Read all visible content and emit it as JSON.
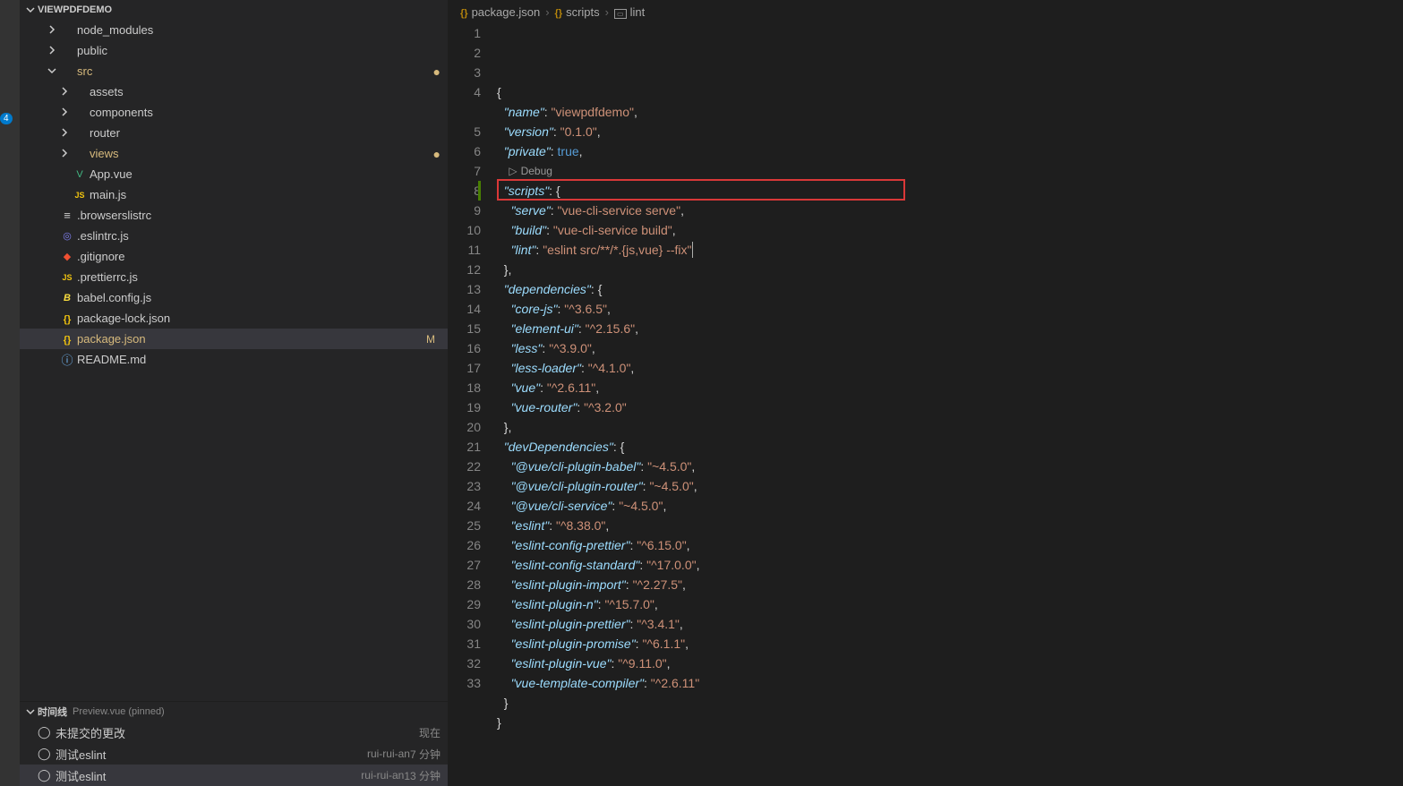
{
  "activity": {
    "badge": "4"
  },
  "explorer": {
    "title": "VIEWPDFDEMO",
    "tree": [
      {
        "label": "node_modules",
        "kind": "folder",
        "depth": 2,
        "twisty": "right"
      },
      {
        "label": "public",
        "kind": "folder",
        "depth": 2,
        "twisty": "right"
      },
      {
        "label": "src",
        "kind": "folder",
        "depth": 2,
        "twisty": "down",
        "mod": true,
        "dot": true
      },
      {
        "label": "assets",
        "kind": "folder",
        "depth": 3,
        "twisty": "right"
      },
      {
        "label": "components",
        "kind": "folder",
        "depth": 3,
        "twisty": "right"
      },
      {
        "label": "router",
        "kind": "folder",
        "depth": 3,
        "twisty": "right"
      },
      {
        "label": "views",
        "kind": "folder",
        "depth": 3,
        "twisty": "right",
        "mod": true,
        "dot": true
      },
      {
        "label": "App.vue",
        "kind": "file",
        "depth": 3,
        "icon": "vue"
      },
      {
        "label": "main.js",
        "kind": "file",
        "depth": 3,
        "icon": "js"
      },
      {
        "label": ".browserslistrc",
        "kind": "file",
        "depth": 2,
        "icon": "list"
      },
      {
        "label": ".eslintrc.js",
        "kind": "file",
        "depth": 2,
        "icon": "eslint"
      },
      {
        "label": ".gitignore",
        "kind": "file",
        "depth": 2,
        "icon": "git"
      },
      {
        "label": ".prettierrc.js",
        "kind": "file",
        "depth": 2,
        "icon": "js"
      },
      {
        "label": "babel.config.js",
        "kind": "file",
        "depth": 2,
        "icon": "babel"
      },
      {
        "label": "package-lock.json",
        "kind": "file",
        "depth": 2,
        "icon": "json"
      },
      {
        "label": "package.json",
        "kind": "file",
        "depth": 2,
        "icon": "json",
        "selected": true,
        "fileMod": true,
        "badge": "M"
      },
      {
        "label": "README.md",
        "kind": "file",
        "depth": 2,
        "icon": "info"
      }
    ]
  },
  "timeline": {
    "header_label": "时间线",
    "pinned_label": "Preview.vue (pinned)",
    "items": [
      {
        "msg": "未提交的更改",
        "meta": "",
        "time": "现在",
        "selected": false
      },
      {
        "msg": "测试eslint",
        "meta": "rui-rui-an",
        "time": "7 分钟",
        "selected": false
      },
      {
        "msg": "测试eslint",
        "meta": "rui-rui-an",
        "time": "13 分钟",
        "selected": true
      }
    ]
  },
  "breadcrumbs": [
    "package.json",
    "scripts",
    "lint"
  ],
  "code": {
    "debug_label": "Debug",
    "lines": [
      {
        "n": 1,
        "raw": "{",
        "tok": [
          {
            "t": "{",
            "c": "brace"
          }
        ]
      },
      {
        "n": 2,
        "raw": "  \"name\": \"viewpdfdemo\",",
        "tok": [
          {
            "t": "  "
          },
          {
            "t": "\"name\"",
            "c": "key"
          },
          {
            "t": ": ",
            "c": "punct"
          },
          {
            "t": "\"viewpdfdemo\"",
            "c": "str"
          },
          {
            "t": ",",
            "c": "punct"
          }
        ]
      },
      {
        "n": 3,
        "raw": "  \"version\": \"0.1.0\",",
        "tok": [
          {
            "t": "  "
          },
          {
            "t": "\"version\"",
            "c": "key"
          },
          {
            "t": ": ",
            "c": "punct"
          },
          {
            "t": "\"0.1.0\"",
            "c": "str"
          },
          {
            "t": ",",
            "c": "punct"
          }
        ]
      },
      {
        "n": 4,
        "raw": "  \"private\": true,",
        "tok": [
          {
            "t": "  "
          },
          {
            "t": "\"private\"",
            "c": "key"
          },
          {
            "t": ": ",
            "c": "punct"
          },
          {
            "t": "true",
            "c": "bool"
          },
          {
            "t": ",",
            "c": "punct"
          }
        ]
      },
      {
        "n": 0,
        "codelens": true
      },
      {
        "n": 5,
        "raw": "  \"scripts\": {",
        "tok": [
          {
            "t": "  "
          },
          {
            "t": "\"scripts\"",
            "c": "key"
          },
          {
            "t": ": ",
            "c": "punct"
          },
          {
            "t": "{",
            "c": "brace"
          }
        ]
      },
      {
        "n": 6,
        "raw": "    \"serve\": \"vue-cli-service serve\",",
        "tok": [
          {
            "t": "    "
          },
          {
            "t": "\"serve\"",
            "c": "key"
          },
          {
            "t": ": ",
            "c": "punct"
          },
          {
            "t": "\"vue-cli-service serve\"",
            "c": "str"
          },
          {
            "t": ",",
            "c": "punct"
          }
        ]
      },
      {
        "n": 7,
        "raw": "    \"build\": \"vue-cli-service build\",",
        "tok": [
          {
            "t": "    "
          },
          {
            "t": "\"build\"",
            "c": "key"
          },
          {
            "t": ": ",
            "c": "punct"
          },
          {
            "t": "\"vue-cli-service build\"",
            "c": "str"
          },
          {
            "t": ",",
            "c": "punct"
          }
        ]
      },
      {
        "n": 8,
        "mod": "green",
        "hl": true,
        "raw": "    \"lint\": \"eslint src/**/*.{js,vue} --fix\"",
        "tok": [
          {
            "t": "    "
          },
          {
            "t": "\"lint\"",
            "c": "key"
          },
          {
            "t": ": ",
            "c": "punct"
          },
          {
            "t": "\"eslint src/**/*.{js,vue} --fix\"",
            "c": "str"
          }
        ],
        "cursor": true
      },
      {
        "n": 9,
        "raw": "  },",
        "tok": [
          {
            "t": "  "
          },
          {
            "t": "}",
            "c": "brace"
          },
          {
            "t": ",",
            "c": "punct"
          }
        ]
      },
      {
        "n": 10,
        "raw": "  \"dependencies\": {",
        "tok": [
          {
            "t": "  "
          },
          {
            "t": "\"dependencies\"",
            "c": "key"
          },
          {
            "t": ": ",
            "c": "punct"
          },
          {
            "t": "{",
            "c": "brace"
          }
        ]
      },
      {
        "n": 11,
        "raw": "    \"core-js\": \"^3.6.5\",",
        "tok": [
          {
            "t": "    "
          },
          {
            "t": "\"core-js\"",
            "c": "key"
          },
          {
            "t": ": ",
            "c": "punct"
          },
          {
            "t": "\"^3.6.5\"",
            "c": "str"
          },
          {
            "t": ",",
            "c": "punct"
          }
        ]
      },
      {
        "n": 12,
        "raw": "    \"element-ui\": \"^2.15.6\",",
        "tok": [
          {
            "t": "    "
          },
          {
            "t": "\"element-ui\"",
            "c": "key"
          },
          {
            "t": ": ",
            "c": "punct"
          },
          {
            "t": "\"^2.15.6\"",
            "c": "str"
          },
          {
            "t": ",",
            "c": "punct"
          }
        ]
      },
      {
        "n": 13,
        "raw": "    \"less\": \"^3.9.0\",",
        "tok": [
          {
            "t": "    "
          },
          {
            "t": "\"less\"",
            "c": "key"
          },
          {
            "t": ": ",
            "c": "punct"
          },
          {
            "t": "\"^3.9.0\"",
            "c": "str"
          },
          {
            "t": ",",
            "c": "punct"
          }
        ]
      },
      {
        "n": 14,
        "raw": "    \"less-loader\": \"^4.1.0\",",
        "tok": [
          {
            "t": "    "
          },
          {
            "t": "\"less-loader\"",
            "c": "key"
          },
          {
            "t": ": ",
            "c": "punct"
          },
          {
            "t": "\"^4.1.0\"",
            "c": "str"
          },
          {
            "t": ",",
            "c": "punct"
          }
        ]
      },
      {
        "n": 15,
        "raw": "    \"vue\": \"^2.6.11\",",
        "tok": [
          {
            "t": "    "
          },
          {
            "t": "\"vue\"",
            "c": "key"
          },
          {
            "t": ": ",
            "c": "punct"
          },
          {
            "t": "\"^2.6.11\"",
            "c": "str"
          },
          {
            "t": ",",
            "c": "punct"
          }
        ]
      },
      {
        "n": 16,
        "raw": "    \"vue-router\": \"^3.2.0\"",
        "tok": [
          {
            "t": "    "
          },
          {
            "t": "\"vue-router\"",
            "c": "key"
          },
          {
            "t": ": ",
            "c": "punct"
          },
          {
            "t": "\"^3.2.0\"",
            "c": "str"
          }
        ]
      },
      {
        "n": 17,
        "raw": "  },",
        "tok": [
          {
            "t": "  "
          },
          {
            "t": "}",
            "c": "brace"
          },
          {
            "t": ",",
            "c": "punct"
          }
        ]
      },
      {
        "n": 18,
        "raw": "  \"devDependencies\": {",
        "tok": [
          {
            "t": "  "
          },
          {
            "t": "\"devDependencies\"",
            "c": "key"
          },
          {
            "t": ": ",
            "c": "punct"
          },
          {
            "t": "{",
            "c": "brace"
          }
        ]
      },
      {
        "n": 19,
        "raw": "    \"@vue/cli-plugin-babel\": \"~4.5.0\",",
        "tok": [
          {
            "t": "    "
          },
          {
            "t": "\"@vue/cli-plugin-babel\"",
            "c": "key"
          },
          {
            "t": ": ",
            "c": "punct"
          },
          {
            "t": "\"~4.5.0\"",
            "c": "str"
          },
          {
            "t": ",",
            "c": "punct"
          }
        ]
      },
      {
        "n": 20,
        "raw": "    \"@vue/cli-plugin-router\": \"~4.5.0\",",
        "tok": [
          {
            "t": "    "
          },
          {
            "t": "\"@vue/cli-plugin-router\"",
            "c": "key"
          },
          {
            "t": ": ",
            "c": "punct"
          },
          {
            "t": "\"~4.5.0\"",
            "c": "str"
          },
          {
            "t": ",",
            "c": "punct"
          }
        ]
      },
      {
        "n": 21,
        "raw": "    \"@vue/cli-service\": \"~4.5.0\",",
        "tok": [
          {
            "t": "    "
          },
          {
            "t": "\"@vue/cli-service\"",
            "c": "key"
          },
          {
            "t": ": ",
            "c": "punct"
          },
          {
            "t": "\"~4.5.0\"",
            "c": "str"
          },
          {
            "t": ",",
            "c": "punct"
          }
        ]
      },
      {
        "n": 22,
        "raw": "    \"eslint\": \"^8.38.0\",",
        "tok": [
          {
            "t": "    "
          },
          {
            "t": "\"eslint\"",
            "c": "key"
          },
          {
            "t": ": ",
            "c": "punct"
          },
          {
            "t": "\"^8.38.0\"",
            "c": "str"
          },
          {
            "t": ",",
            "c": "punct"
          }
        ]
      },
      {
        "n": 23,
        "raw": "    \"eslint-config-prettier\": \"^6.15.0\",",
        "tok": [
          {
            "t": "    "
          },
          {
            "t": "\"eslint-config-prettier\"",
            "c": "key"
          },
          {
            "t": ": ",
            "c": "punct"
          },
          {
            "t": "\"^6.15.0\"",
            "c": "str"
          },
          {
            "t": ",",
            "c": "punct"
          }
        ]
      },
      {
        "n": 24,
        "raw": "    \"eslint-config-standard\": \"^17.0.0\",",
        "tok": [
          {
            "t": "    "
          },
          {
            "t": "\"eslint-config-standard\"",
            "c": "key"
          },
          {
            "t": ": ",
            "c": "punct"
          },
          {
            "t": "\"^17.0.0\"",
            "c": "str"
          },
          {
            "t": ",",
            "c": "punct"
          }
        ]
      },
      {
        "n": 25,
        "raw": "    \"eslint-plugin-import\": \"^2.27.5\",",
        "tok": [
          {
            "t": "    "
          },
          {
            "t": "\"eslint-plugin-import\"",
            "c": "key"
          },
          {
            "t": ": ",
            "c": "punct"
          },
          {
            "t": "\"^2.27.5\"",
            "c": "str"
          },
          {
            "t": ",",
            "c": "punct"
          }
        ]
      },
      {
        "n": 26,
        "raw": "    \"eslint-plugin-n\": \"^15.7.0\",",
        "tok": [
          {
            "t": "    "
          },
          {
            "t": "\"eslint-plugin-n\"",
            "c": "key"
          },
          {
            "t": ": ",
            "c": "punct"
          },
          {
            "t": "\"^15.7.0\"",
            "c": "str"
          },
          {
            "t": ",",
            "c": "punct"
          }
        ]
      },
      {
        "n": 27,
        "raw": "    \"eslint-plugin-prettier\": \"^3.4.1\",",
        "tok": [
          {
            "t": "    "
          },
          {
            "t": "\"eslint-plugin-prettier\"",
            "c": "key"
          },
          {
            "t": ": ",
            "c": "punct"
          },
          {
            "t": "\"^3.4.1\"",
            "c": "str"
          },
          {
            "t": ",",
            "c": "punct"
          }
        ]
      },
      {
        "n": 28,
        "raw": "    \"eslint-plugin-promise\": \"^6.1.1\",",
        "tok": [
          {
            "t": "    "
          },
          {
            "t": "\"eslint-plugin-promise\"",
            "c": "key"
          },
          {
            "t": ": ",
            "c": "punct"
          },
          {
            "t": "\"^6.1.1\"",
            "c": "str"
          },
          {
            "t": ",",
            "c": "punct"
          }
        ]
      },
      {
        "n": 29,
        "raw": "    \"eslint-plugin-vue\": \"^9.11.0\",",
        "tok": [
          {
            "t": "    "
          },
          {
            "t": "\"eslint-plugin-vue\"",
            "c": "key"
          },
          {
            "t": ": ",
            "c": "punct"
          },
          {
            "t": "\"^9.11.0\"",
            "c": "str"
          },
          {
            "t": ",",
            "c": "punct"
          }
        ]
      },
      {
        "n": 30,
        "raw": "    \"vue-template-compiler\": \"^2.6.11\"",
        "tok": [
          {
            "t": "    "
          },
          {
            "t": "\"vue-template-compiler\"",
            "c": "key"
          },
          {
            "t": ": ",
            "c": "punct"
          },
          {
            "t": "\"^2.6.11\"",
            "c": "str"
          }
        ]
      },
      {
        "n": 31,
        "raw": "  }",
        "tok": [
          {
            "t": "  "
          },
          {
            "t": "}",
            "c": "brace"
          }
        ]
      },
      {
        "n": 32,
        "raw": "}",
        "tok": [
          {
            "t": "}",
            "c": "brace"
          }
        ]
      },
      {
        "n": 33,
        "raw": "",
        "tok": []
      }
    ]
  }
}
